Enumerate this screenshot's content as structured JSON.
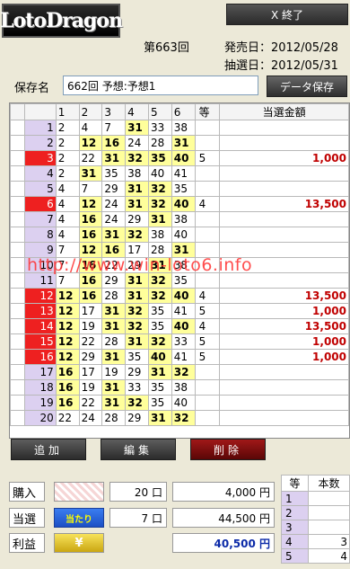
{
  "header": {
    "logo": "LotoDragon",
    "close_label": "X 終了",
    "round": "第663回",
    "sale_date": "発売日：2012/05/28",
    "draw_date": "抽選日：2012/05/31"
  },
  "save": {
    "label": "保存名",
    "value": "662回 予想:予想1",
    "button": "データ保存"
  },
  "table": {
    "headers": [
      "1",
      "2",
      "3",
      "4",
      "5",
      "6",
      "等",
      "当選金額"
    ],
    "rows": [
      {
        "no": "1",
        "hit": false,
        "nums": [
          "2",
          "4",
          "7",
          "31",
          "33",
          "38"
        ],
        "match": [
          false,
          false,
          false,
          true,
          false,
          false
        ],
        "rank": "",
        "prize": ""
      },
      {
        "no": "2",
        "hit": false,
        "nums": [
          "2",
          "12",
          "16",
          "24",
          "28",
          "31"
        ],
        "match": [
          false,
          true,
          true,
          false,
          false,
          true
        ],
        "rank": "",
        "prize": ""
      },
      {
        "no": "3",
        "hit": true,
        "nums": [
          "2",
          "22",
          "31",
          "32",
          "35",
          "40"
        ],
        "match": [
          false,
          false,
          true,
          true,
          true,
          true
        ],
        "rank": "5",
        "prize": "1,000"
      },
      {
        "no": "4",
        "hit": false,
        "nums": [
          "2",
          "31",
          "35",
          "38",
          "40",
          "41"
        ],
        "match": [
          false,
          true,
          false,
          false,
          false,
          false
        ],
        "rank": "",
        "prize": ""
      },
      {
        "no": "5",
        "hit": false,
        "nums": [
          "4",
          "7",
          "29",
          "31",
          "32",
          "35"
        ],
        "match": [
          false,
          false,
          false,
          true,
          true,
          false
        ],
        "rank": "",
        "prize": ""
      },
      {
        "no": "6",
        "hit": true,
        "nums": [
          "4",
          "12",
          "24",
          "31",
          "32",
          "40"
        ],
        "match": [
          false,
          true,
          false,
          true,
          true,
          true
        ],
        "rank": "4",
        "prize": "13,500"
      },
      {
        "no": "7",
        "hit": false,
        "nums": [
          "4",
          "16",
          "24",
          "29",
          "31",
          "38"
        ],
        "match": [
          false,
          true,
          false,
          false,
          true,
          false
        ],
        "rank": "",
        "prize": ""
      },
      {
        "no": "8",
        "hit": false,
        "nums": [
          "4",
          "16",
          "31",
          "32",
          "38",
          "40"
        ],
        "match": [
          false,
          true,
          true,
          true,
          false,
          false
        ],
        "rank": "",
        "prize": ""
      },
      {
        "no": "9",
        "hit": false,
        "nums": [
          "7",
          "12",
          "16",
          "17",
          "28",
          "31"
        ],
        "match": [
          false,
          true,
          true,
          false,
          false,
          true
        ],
        "rank": "",
        "prize": ""
      },
      {
        "no": "10",
        "hit": false,
        "nums": [
          "7",
          "16",
          "22",
          "29",
          "31",
          "38"
        ],
        "match": [
          false,
          true,
          false,
          false,
          true,
          false
        ],
        "rank": "",
        "prize": ""
      },
      {
        "no": "11",
        "hit": false,
        "nums": [
          "7",
          "16",
          "29",
          "31",
          "32",
          "35"
        ],
        "match": [
          false,
          true,
          false,
          true,
          true,
          false
        ],
        "rank": "",
        "prize": ""
      },
      {
        "no": "12",
        "hit": true,
        "nums": [
          "12",
          "16",
          "28",
          "31",
          "32",
          "40"
        ],
        "match": [
          true,
          true,
          false,
          true,
          true,
          true
        ],
        "rank": "4",
        "prize": "13,500"
      },
      {
        "no": "13",
        "hit": true,
        "nums": [
          "12",
          "17",
          "31",
          "32",
          "35",
          "41"
        ],
        "match": [
          true,
          false,
          true,
          true,
          false,
          false
        ],
        "rank": "5",
        "prize": "1,000"
      },
      {
        "no": "14",
        "hit": true,
        "nums": [
          "12",
          "19",
          "31",
          "32",
          "35",
          "40"
        ],
        "match": [
          true,
          false,
          true,
          true,
          false,
          true
        ],
        "rank": "4",
        "prize": "13,500"
      },
      {
        "no": "15",
        "hit": true,
        "nums": [
          "12",
          "22",
          "28",
          "31",
          "32",
          "33"
        ],
        "match": [
          true,
          false,
          false,
          true,
          true,
          false
        ],
        "rank": "5",
        "prize": "1,000"
      },
      {
        "no": "16",
        "hit": true,
        "nums": [
          "12",
          "29",
          "31",
          "35",
          "40",
          "41"
        ],
        "match": [
          true,
          false,
          true,
          false,
          true,
          false
        ],
        "rank": "5",
        "prize": "1,000"
      },
      {
        "no": "17",
        "hit": false,
        "nums": [
          "16",
          "17",
          "19",
          "29",
          "31",
          "32"
        ],
        "match": [
          true,
          false,
          false,
          false,
          true,
          true
        ],
        "rank": "",
        "prize": ""
      },
      {
        "no": "18",
        "hit": false,
        "nums": [
          "16",
          "19",
          "31",
          "33",
          "35",
          "38"
        ],
        "match": [
          true,
          false,
          true,
          false,
          false,
          false
        ],
        "rank": "",
        "prize": ""
      },
      {
        "no": "19",
        "hit": false,
        "nums": [
          "16",
          "22",
          "31",
          "32",
          "35",
          "40"
        ],
        "match": [
          true,
          false,
          true,
          true,
          false,
          false
        ],
        "rank": "",
        "prize": ""
      },
      {
        "no": "20",
        "hit": false,
        "nums": [
          "22",
          "24",
          "28",
          "29",
          "31",
          "32"
        ],
        "match": [
          false,
          false,
          false,
          false,
          true,
          true
        ],
        "rank": "",
        "prize": ""
      }
    ]
  },
  "watermark": "http://www.win-loto6.info",
  "buttons": {
    "add": "追加",
    "edit": "編集",
    "delete": "削除"
  },
  "summary": {
    "purchase_label": "購入",
    "purchase_count": "20 口",
    "purchase_amount": "4,000 円",
    "win_label": "当選",
    "win_badge": "当たり",
    "win_count": "7 口",
    "win_amount": "44,500 円",
    "profit_label": "利益",
    "profit_badge": "¥",
    "profit_amount": "40,500 円"
  },
  "rank_counts": {
    "headers": [
      "等",
      "本数"
    ],
    "rows": [
      {
        "rank": "1",
        "count": ""
      },
      {
        "rank": "2",
        "count": ""
      },
      {
        "rank": "3",
        "count": ""
      },
      {
        "rank": "4",
        "count": "3"
      },
      {
        "rank": "5",
        "count": "4"
      }
    ]
  },
  "colors": {
    "hit_row": "#ee2020",
    "match_cell": "#ffff9b",
    "prize_text": "#c00000",
    "profit_text": "#0b2aa8"
  }
}
